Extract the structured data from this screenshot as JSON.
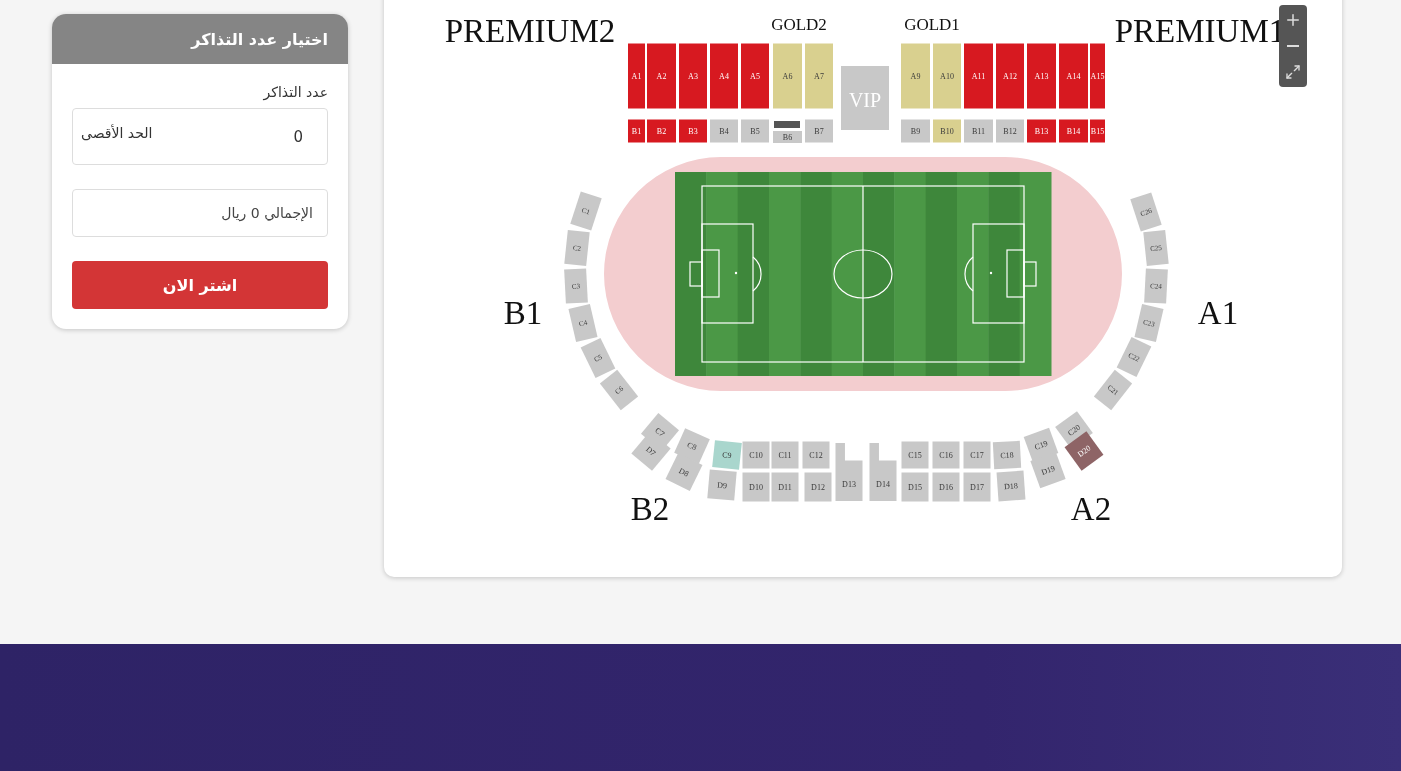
{
  "ticket_panel": {
    "title": "اختيار عدد التذاكر",
    "count_label": "عدد التذاكر",
    "count_field": {
      "value": "0",
      "max_label": "الحد الأقصى"
    },
    "total_field": {
      "value": "الإجمالي 0 ريال"
    },
    "buy_button": "اشتر الان"
  },
  "seat_map": {
    "zone_labels": [
      {
        "text": "PREMIUM2",
        "kind": "major"
      },
      {
        "text": "GOLD2",
        "kind": "minor"
      },
      {
        "text": "GOLD1",
        "kind": "minor"
      },
      {
        "text": "PREMIUM1",
        "kind": "major"
      },
      {
        "text": "B1",
        "kind": "major"
      },
      {
        "text": "A1",
        "kind": "major"
      },
      {
        "text": "B2",
        "kind": "major"
      },
      {
        "text": "A2",
        "kind": "major"
      }
    ],
    "vip": "VIP",
    "upper_blocks": [
      {
        "label": "A1",
        "color": "#d71920"
      },
      {
        "label": "A2",
        "color": "#d71920"
      },
      {
        "label": "A3",
        "color": "#d71920"
      },
      {
        "label": "A4",
        "color": "#d71920"
      },
      {
        "label": "A5",
        "color": "#d71920"
      },
      {
        "label": "A6",
        "color": "#d9d08f"
      },
      {
        "label": "A7",
        "color": "#d9d08f"
      },
      {
        "label": "A9",
        "color": "#d9d08f"
      },
      {
        "label": "A10",
        "color": "#d9d08f"
      },
      {
        "label": "A11",
        "color": "#d71920"
      },
      {
        "label": "A12",
        "color": "#d71920"
      },
      {
        "label": "A13",
        "color": "#d71920"
      },
      {
        "label": "A14",
        "color": "#d71920"
      },
      {
        "label": "A15",
        "color": "#d71920"
      }
    ],
    "lower_blocks": [
      {
        "label": "B1",
        "color": "#d71920"
      },
      {
        "label": "B2",
        "color": "#d71920"
      },
      {
        "label": "B3",
        "color": "#d71920"
      },
      {
        "label": "B4",
        "color": "#c8c8c8"
      },
      {
        "label": "B5",
        "color": "#c8c8c8"
      },
      {
        "label": "B6",
        "color": "#c8c8c8"
      },
      {
        "label": "B7",
        "color": "#c8c8c8"
      },
      {
        "label": "B9",
        "color": "#c8c8c8"
      },
      {
        "label": "B10",
        "color": "#d9d08f"
      },
      {
        "label": "B11",
        "color": "#c8c8c8"
      },
      {
        "label": "B12",
        "color": "#c8c8c8"
      },
      {
        "label": "B13",
        "color": "#d71920"
      },
      {
        "label": "B14",
        "color": "#d71920"
      },
      {
        "label": "B15",
        "color": "#d71920"
      }
    ],
    "left_arc": [
      {
        "label": "C1",
        "color": "#c8c8c8"
      },
      {
        "label": "C2",
        "color": "#c8c8c8"
      },
      {
        "label": "C3",
        "color": "#c8c8c8"
      },
      {
        "label": "C4",
        "color": "#c8c8c8"
      },
      {
        "label": "C5",
        "color": "#c8c8c8"
      },
      {
        "label": "C6",
        "color": "#c8c8c8"
      }
    ],
    "right_arc": [
      {
        "label": "C26",
        "color": "#c8c8c8"
      },
      {
        "label": "C25",
        "color": "#c8c8c8"
      },
      {
        "label": "C24",
        "color": "#c8c8c8"
      },
      {
        "label": "C23",
        "color": "#c8c8c8"
      },
      {
        "label": "C22",
        "color": "#c8c8c8"
      },
      {
        "label": "C21",
        "color": "#c8c8c8"
      }
    ],
    "inner_ring": [
      {
        "label": "C7",
        "color": "#c8c8c8"
      },
      {
        "label": "C8",
        "color": "#c8c8c8"
      },
      {
        "label": "C9",
        "color": "#a9d6cd"
      },
      {
        "label": "C10",
        "color": "#c8c8c8"
      },
      {
        "label": "C11",
        "color": "#c8c8c8"
      },
      {
        "label": "C12",
        "color": "#c8c8c8"
      },
      {
        "label": "C15",
        "color": "#c8c8c8"
      },
      {
        "label": "C16",
        "color": "#c8c8c8"
      },
      {
        "label": "C17",
        "color": "#c8c8c8"
      },
      {
        "label": "C18",
        "color": "#c8c8c8"
      },
      {
        "label": "C19",
        "color": "#c8c8c8"
      },
      {
        "label": "C20",
        "color": "#c8c8c8"
      }
    ],
    "outer_ring": [
      {
        "label": "D7",
        "color": "#c8c8c8",
        "kind": "plain"
      },
      {
        "label": "D8",
        "color": "#c8c8c8",
        "kind": "plain"
      },
      {
        "label": "D9",
        "color": "#c8c8c8",
        "kind": "plain"
      },
      {
        "label": "D10",
        "color": "#c8c8c8",
        "kind": "plain"
      },
      {
        "label": "D11",
        "color": "#c8c8c8",
        "kind": "plain"
      },
      {
        "label": "D12",
        "color": "#c8c8c8",
        "kind": "plain"
      },
      {
        "label": "D13",
        "color": "#c8c8c8",
        "kind": "notched"
      },
      {
        "label": "D14",
        "color": "#c8c8c8",
        "kind": "notched"
      },
      {
        "label": "D15",
        "color": "#c8c8c8",
        "kind": "plain"
      },
      {
        "label": "D16",
        "color": "#c8c8c8",
        "kind": "plain"
      },
      {
        "label": "D17",
        "color": "#c8c8c8",
        "kind": "plain"
      },
      {
        "label": "D18",
        "color": "#c8c8c8",
        "kind": "plain"
      },
      {
        "label": "D19",
        "color": "#c8c8c8",
        "kind": "plain"
      },
      {
        "label": "D20",
        "color": "#8e6466",
        "kind": "plain"
      }
    ]
  }
}
